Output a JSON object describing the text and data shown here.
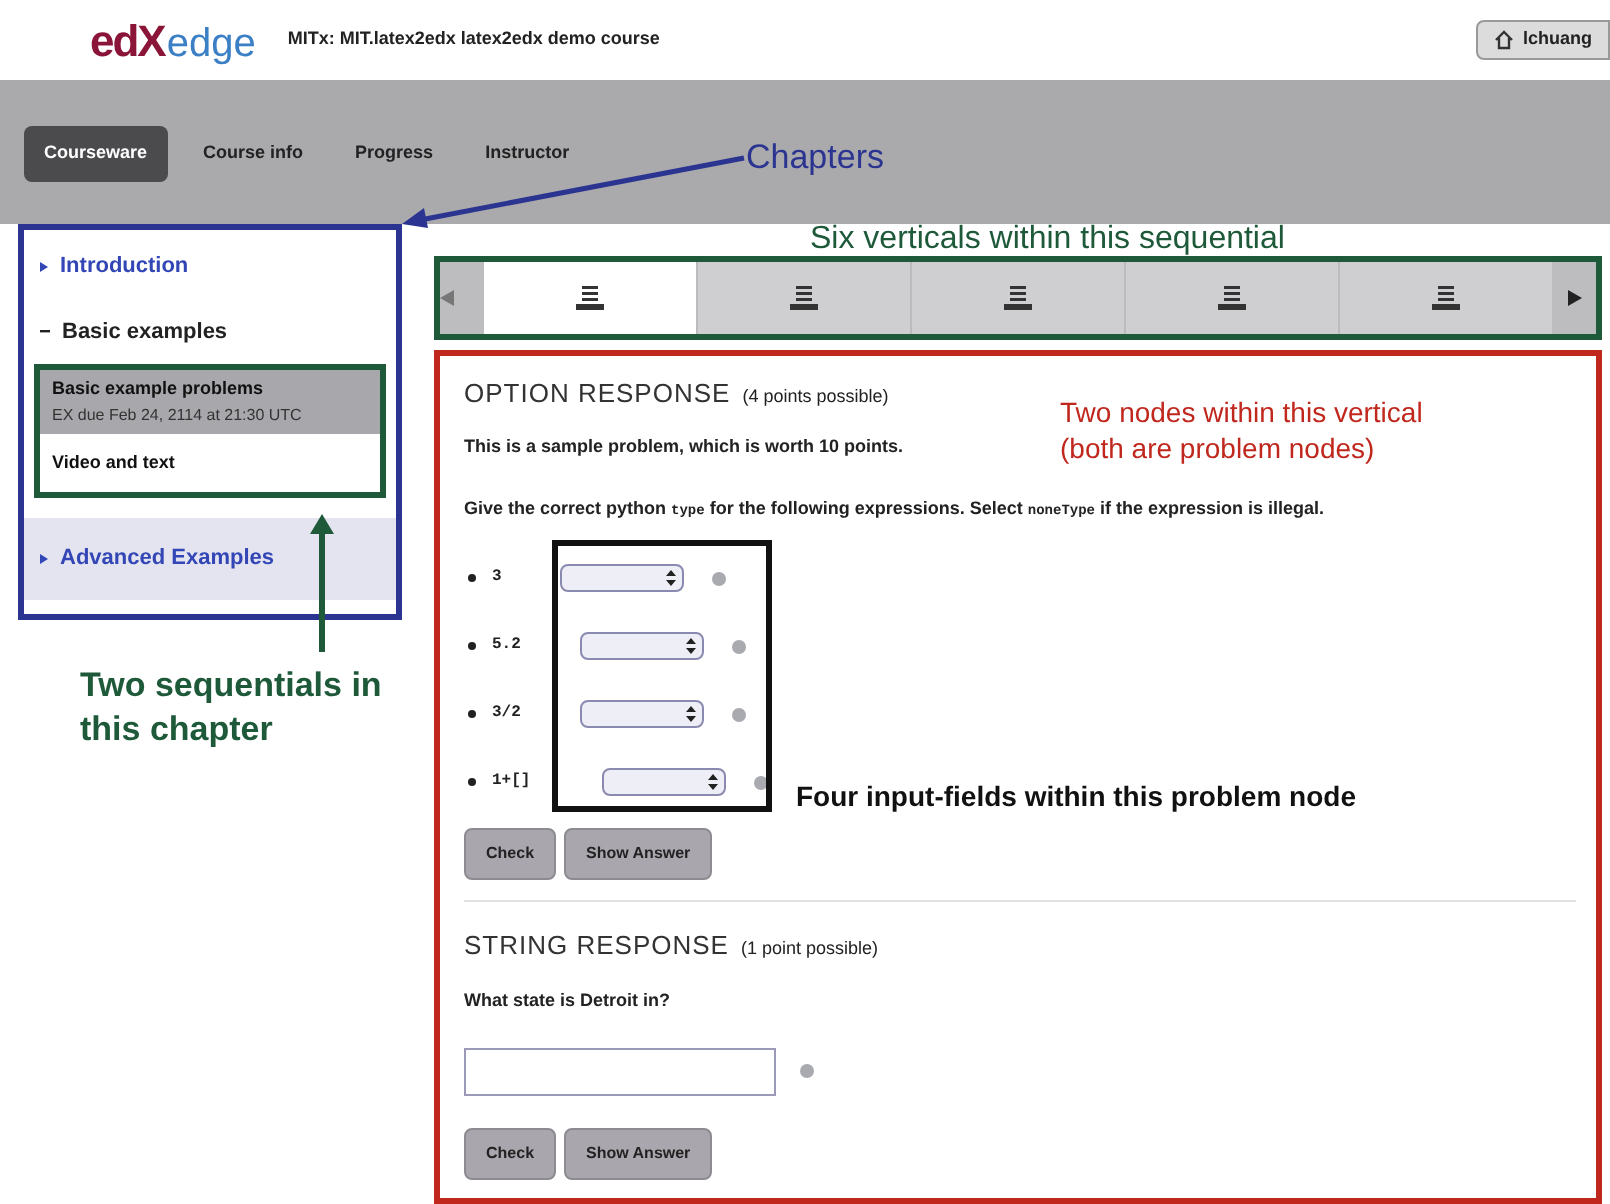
{
  "header": {
    "logo_brand": "edX",
    "logo_product": "edge",
    "course": "MITx: MIT.latex2edx latex2edx demo course",
    "user": "lchuang"
  },
  "nav_tabs": [
    {
      "label": "Courseware",
      "selected": true
    },
    {
      "label": "Course info",
      "selected": false
    },
    {
      "label": "Progress",
      "selected": false
    },
    {
      "label": "Instructor",
      "selected": false
    }
  ],
  "chapters": [
    {
      "title": "Introduction",
      "expanded": false
    },
    {
      "title": "Basic examples",
      "expanded": true,
      "sequentials": [
        {
          "title": "Basic example problems",
          "subtitle": "EX due Feb 24, 2114 at 21:30 UTC",
          "selected": true
        },
        {
          "title": "Video and text",
          "selected": false
        }
      ]
    },
    {
      "title": "Advanced Examples",
      "expanded": false
    }
  ],
  "sequence_nav": {
    "verticals": [
      {
        "selected": true
      },
      {
        "selected": false
      },
      {
        "selected": false
      },
      {
        "selected": false
      },
      {
        "selected": false
      }
    ]
  },
  "problems": [
    {
      "kind": "option",
      "heading": "OPTION RESPONSE",
      "points": "(4 points possible)",
      "intro": "This is a sample problem, which is worth 10 points.",
      "prompt": [
        {
          "kind": "text",
          "text": "Give the correct python "
        },
        {
          "kind": "code",
          "text": "type"
        },
        {
          "kind": "text",
          "text": " for the following expressions. Select "
        },
        {
          "kind": "code",
          "text": "noneType"
        },
        {
          "kind": "text",
          "text": " if the expression is illegal."
        }
      ],
      "items": [
        {
          "expression": "3"
        },
        {
          "expression": "5.2"
        },
        {
          "expression": "3/2"
        },
        {
          "expression": "1+[]"
        }
      ],
      "buttons": [
        "Check",
        "Show Answer"
      ]
    },
    {
      "kind": "string",
      "heading": "STRING RESPONSE",
      "points": "(1 point possible)",
      "question": "What state is Detroit in?",
      "buttons": [
        "Check",
        "Show Answer"
      ]
    }
  ],
  "annotations": [
    {
      "kind": "chapters",
      "text": "Chapters",
      "color": "#2b3591"
    },
    {
      "kind": "verticals",
      "text": "Six verticals within this sequential",
      "color": "#1e5a3a"
    },
    {
      "kind": "sequentials",
      "text": "Two sequentials in this chapter",
      "color": "#1e5a3a"
    },
    {
      "kind": "nodes",
      "text": "Two nodes within this vertical (both are problem nodes)",
      "color": "#c0281e"
    },
    {
      "kind": "inputs",
      "text": "Four input-fields within this problem node",
      "color": "#111111"
    }
  ]
}
